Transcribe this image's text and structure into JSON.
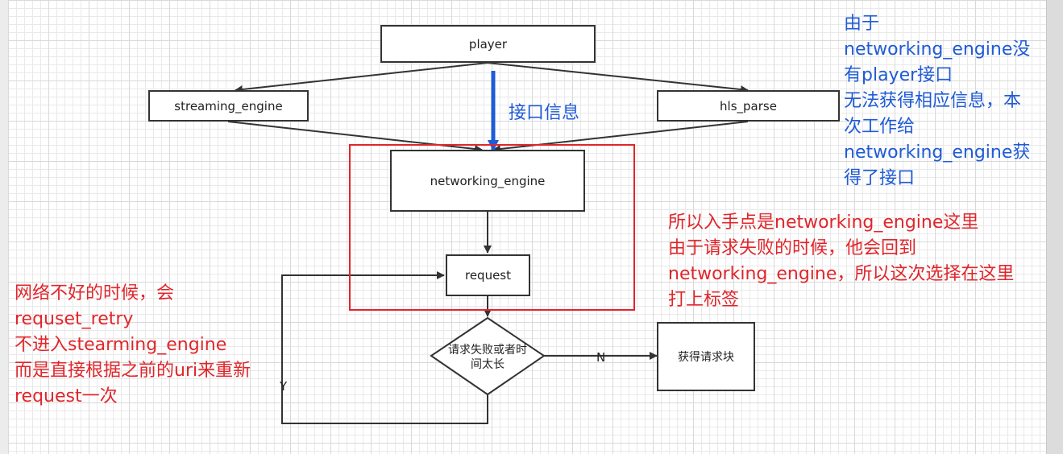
{
  "nodes": {
    "player": "player",
    "streaming_engine": "streaming_engine",
    "hls_parse": "hls_parse",
    "networking_engine": "networking_engine",
    "request": "request",
    "decision": [
      "请求失败或者时",
      "间太长"
    ],
    "get_block": "获得请求块"
  },
  "edge_labels": {
    "no": "N",
    "yes": "Y",
    "interface_info": "接口信息"
  },
  "notes": {
    "top_right": [
      "由于",
      "networking_engine没",
      "有player接口",
      "无法获得相应信息，本",
      "次工作给",
      "networking_engine获",
      "得了接口"
    ],
    "middle_right": [
      "所以入手点是networking_engine这里",
      "由于请求失败的时候，他会回到",
      "networking_engine，所以这次选择在这里",
      "打上标签"
    ],
    "left": [
      "网络不好的时候，会",
      "requset_retry",
      "不进入stearming_engine",
      "而是直接根据之前的uri来重新",
      "request一次"
    ]
  },
  "colors": {
    "red": "#e0262b",
    "blue": "#1f5bd6",
    "line": "#333333"
  }
}
